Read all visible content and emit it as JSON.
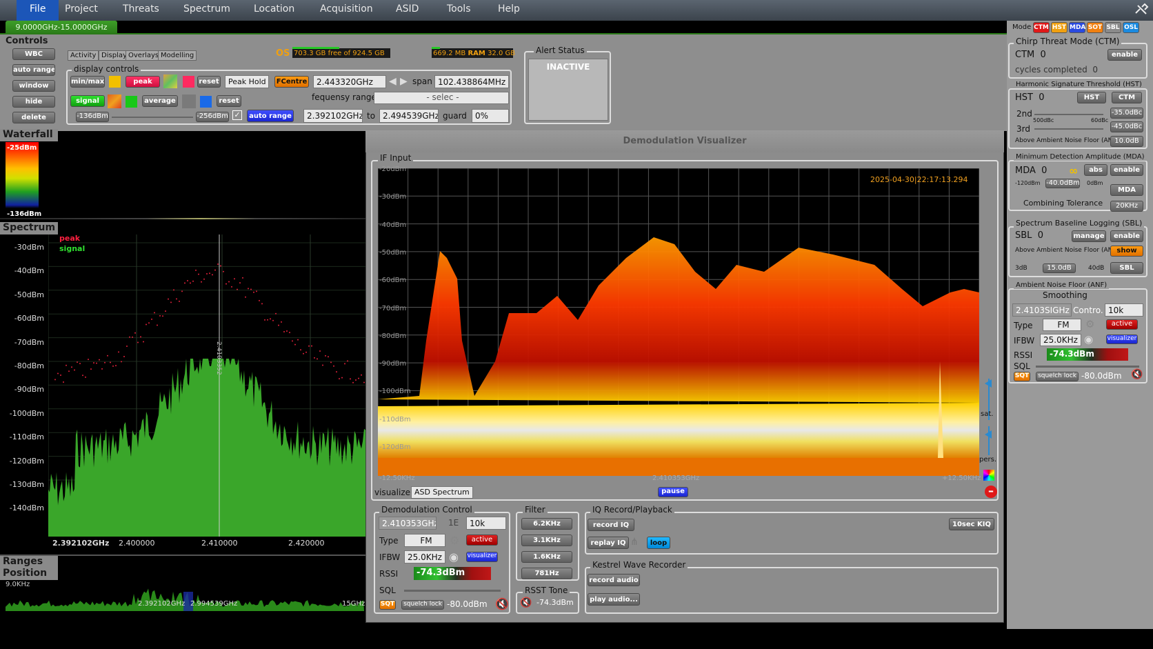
{
  "menu": {
    "items": [
      "File",
      "Project",
      "Threats",
      "Spectrum",
      "Location",
      "Acquisition",
      "ASID",
      "Tools",
      "Help"
    ]
  },
  "freq_tab": "9.0000GHz-15.0000GHz",
  "controls": {
    "title": "Controls",
    "buttons": [
      "WBC",
      "auto range",
      "window",
      "hide",
      "delete"
    ]
  },
  "tabs": [
    "Activity",
    "Display",
    "Overlays",
    "Modelling"
  ],
  "display_controls": {
    "title": "display controls",
    "minmax": "min/max",
    "peak": "peak",
    "reset": "reset",
    "peak_hold": "Peak Hold",
    "fcentre": "FCentre",
    "fcentre_val": "2.443320GHz",
    "span_label": "span",
    "span_val": "102.438864MHz",
    "signal": "signal",
    "average": "average",
    "reset2": "reset",
    "fr_label": "fequensy range",
    "fr_sel": "- selec -",
    "min_db": "-136dBm",
    "max_db": "-256dBm",
    "auto_range": "auto range",
    "from": "2.392102GHz",
    "to_label": "to",
    "to": "2.494539GHz",
    "guard_label": "guard",
    "guard": "0%"
  },
  "os": {
    "label": "OS",
    "disk": "703.3 GB free of 924.5 GB",
    "ram_used": "669.2 MB",
    "ram_label": "RAM",
    "ram_total": "32.0 GB"
  },
  "alert": {
    "title": "Alert Status",
    "status": "INACTIVE"
  },
  "waterfall": {
    "title": "Waterfall",
    "top": "-25dBm",
    "bottom": "-136dBm"
  },
  "spectrum": {
    "title": "Spectrum",
    "legend_peak": "peak",
    "legend_signal": "signal",
    "marker": "2.4103352",
    "yticks": [
      "-30dBm",
      "-40dBm",
      "-50dBm",
      "-60dBm",
      "-70dBm",
      "-80dBm",
      "-90dBm",
      "-100dBm",
      "-110dBm",
      "-120dBm",
      "-130dBm",
      "-140dBm"
    ],
    "xticks": [
      "2.392102GHz",
      "2.400000",
      "2.410000",
      "2.420000"
    ]
  },
  "ranges": {
    "title1": "Ranges",
    "title2": "Position",
    "top": "9.0KHz",
    "left": "2.392102GHz",
    "right": "2.994539GHz",
    "end": "15GHz"
  },
  "demod_vis": {
    "title": "Demodulation Visualizer",
    "if_input": "IF Input",
    "timestamp": "2025-04-30|22:17:13.294",
    "yticks": [
      "-20dBm",
      "-30dBm",
      "-40dBm",
      "-50dBm",
      "-60dBm",
      "-70dBm",
      "-80dBm",
      "-90dBm",
      "-100dBm",
      "-110dBm",
      "-120dBm"
    ],
    "xleft": "-12.50KHz",
    "xmid": "2.410353GHz",
    "xright": "+12.50KHz",
    "sat": "sat.",
    "pers": "pers.",
    "visualizer_label": "visualizer",
    "visualizer_val": "ASD Spectrum",
    "pause": "pause"
  },
  "demod_ctrl": {
    "title": "Demodulation Control",
    "freq": "2.410353GHz",
    "step1": "1E",
    "step2": "10k",
    "type_label": "Type",
    "type": "FM",
    "active": "active",
    "ifbw_label": "IFBW",
    "ifbw": "25.0KHz",
    "visualizer": "visualizer",
    "rssi_label": "RSSI",
    "rssi": "-74.3dBm",
    "sql_label": "SQL",
    "sqt": "SQT",
    "squelch": "squelch lock",
    "sq_val": "-80.0dBm"
  },
  "filter": {
    "title": "Filter",
    "items": [
      "6.2KHz",
      "3.1KHz",
      "1.6KHz",
      "781Hz"
    ]
  },
  "rsst": {
    "title": "RSST Tone",
    "val": "-74.3dBm"
  },
  "iq": {
    "title": "IQ Record/Playback",
    "record": "record IQ",
    "replay": "replay IQ",
    "loop": "loop",
    "kiq": "10sec KIQ"
  },
  "kestrel": {
    "title": "Kestrel Wave Recorder",
    "record": "record audio",
    "play": "play audio..."
  },
  "mode": {
    "label": "Mode",
    "items": [
      {
        "t": "CTM",
        "c": "#e01818"
      },
      {
        "t": "HST",
        "c": "#f0a010"
      },
      {
        "t": "MDA",
        "c": "#2a4ae0"
      },
      {
        "t": "SOT",
        "c": "#f08010"
      },
      {
        "t": "SBL",
        "c": "#8a8a8a"
      },
      {
        "t": "OSL",
        "c": "#1a8ae0"
      }
    ]
  },
  "ctm": {
    "title": "Chirp Threat Mode (CTM)",
    "label": "CTM",
    "count": "0",
    "enable": "enable",
    "cycles": "cycles completed",
    "cycles_n": "0"
  },
  "hst": {
    "title": "Harmonic Signature Threshold (HST)",
    "label": "HST",
    "count": "0",
    "hst_btn": "HST",
    "ctm_btn": "CTM",
    "second": "2nd",
    "third": "3rd",
    "v2": "-35.0dBc",
    "v3": "-45.0dBc",
    "lo": "500dBc",
    "hi": "60dBc",
    "anf": "Above Ambient Noise Floor (ANF)",
    "anf_val": "10.0dB"
  },
  "mda": {
    "title": "Minimum Detection Amplitude (MDA)",
    "label": "MDA",
    "count": "0",
    "abs": "abs",
    "enable": "enable",
    "lo": "-120dBm",
    "val": "-40.0dBm",
    "hi": "0dBm",
    "mda_btn": "MDA",
    "comb": "Combining Tolerance",
    "comb_val": "20KHz"
  },
  "sbl": {
    "title": "Spectrum Baseline Logging (SBL)",
    "label": "SBL",
    "count": "0",
    "manage": "manage",
    "enable": "enable",
    "anf": "Above Ambient Noise Floor (ANF)",
    "show": "show",
    "lo": "3dB",
    "val": "15.0dB",
    "hi": "40dB",
    "sbl_btn": "SBL"
  },
  "anf": {
    "title": "Ambient Noise Floor (ANF)",
    "smoothing": "Smoothing",
    "freq": "2.4103SIGHz",
    "contro": "Contro.",
    "step": "10k",
    "type_label": "Type",
    "type": "FM",
    "active": "active",
    "ifbw_label": "IFBW",
    "ifbw": "25.0KHz",
    "visualizer": "visualizer",
    "rssi_label": "RSSI",
    "rssi": "-74.3dBm",
    "sql_label": "SQL",
    "sqt": "SQT",
    "squelch": "squelch lock",
    "sq_val": "-80.0dBm"
  }
}
